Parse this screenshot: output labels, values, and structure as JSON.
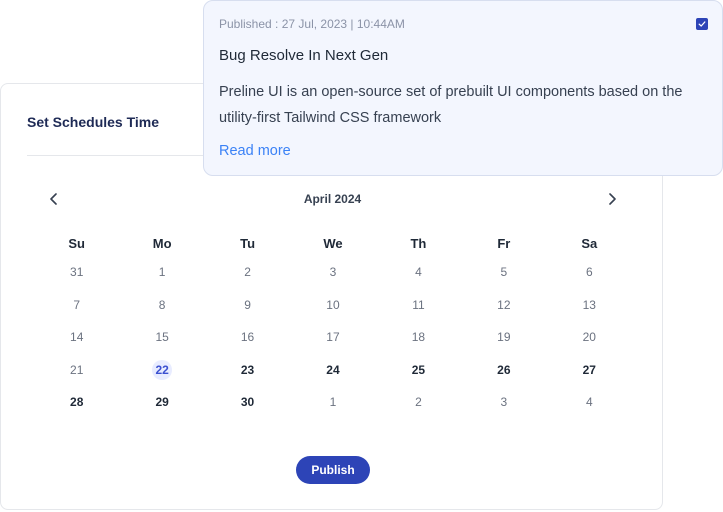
{
  "schedule": {
    "title": "Set Schedules Time",
    "month_label": "April  2024",
    "weekdays": [
      "Su",
      "Mo",
      "Tu",
      "We",
      "Th",
      "Fr",
      "Sa"
    ],
    "days": [
      {
        "label": "31",
        "state": "muted"
      },
      {
        "label": "1",
        "state": "muted"
      },
      {
        "label": "2",
        "state": "muted"
      },
      {
        "label": "3",
        "state": "muted"
      },
      {
        "label": "4",
        "state": "muted"
      },
      {
        "label": "5",
        "state": "muted"
      },
      {
        "label": "6",
        "state": "muted"
      },
      {
        "label": "7",
        "state": "muted"
      },
      {
        "label": "8",
        "state": "muted"
      },
      {
        "label": "9",
        "state": "muted"
      },
      {
        "label": "10",
        "state": "muted"
      },
      {
        "label": "11",
        "state": "muted"
      },
      {
        "label": "12",
        "state": "muted"
      },
      {
        "label": "13",
        "state": "muted"
      },
      {
        "label": "14",
        "state": "muted"
      },
      {
        "label": "15",
        "state": "muted"
      },
      {
        "label": "16",
        "state": "muted"
      },
      {
        "label": "17",
        "state": "muted"
      },
      {
        "label": "18",
        "state": "muted"
      },
      {
        "label": "19",
        "state": "muted"
      },
      {
        "label": "20",
        "state": "muted"
      },
      {
        "label": "21",
        "state": "muted"
      },
      {
        "label": "22",
        "state": "today"
      },
      {
        "label": "23",
        "state": "active"
      },
      {
        "label": "24",
        "state": "active"
      },
      {
        "label": "25",
        "state": "active"
      },
      {
        "label": "26",
        "state": "active"
      },
      {
        "label": "27",
        "state": "active"
      },
      {
        "label": "28",
        "state": "active"
      },
      {
        "label": "29",
        "state": "active"
      },
      {
        "label": "30",
        "state": "active"
      },
      {
        "label": "1",
        "state": "muted"
      },
      {
        "label": "2",
        "state": "muted"
      },
      {
        "label": "3",
        "state": "muted"
      },
      {
        "label": "4",
        "state": "muted"
      }
    ],
    "publish_label": "Publish"
  },
  "notification": {
    "meta": "Published  : 27 Jul, 2023 | 10:44AM",
    "title": "Bug Resolve In Next Gen",
    "body": "Preline UI is an open-source set of prebuilt UI components based on the utility-first Tailwind CSS framework",
    "read_more": "Read more",
    "checked": true
  },
  "colors": {
    "accent": "#2d44b7",
    "link": "#3b82f6",
    "card_bg": "#f3f6fe"
  }
}
